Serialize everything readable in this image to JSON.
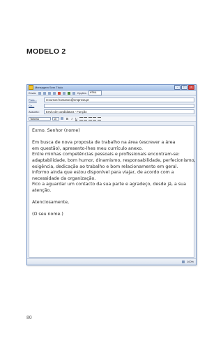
{
  "document": {
    "heading": "MODELO 2",
    "page_number": "80"
  },
  "window": {
    "title": "Mensagem Sem Título",
    "toolbar": {
      "send": "Enviar",
      "options": "Opções",
      "format": "HTML"
    },
    "headers": {
      "to_label": "Para...",
      "to_value": "recursos-humanos@empresa.pt",
      "cc_label": "Cc...",
      "cc_value": "",
      "subject_label": "Assunto:",
      "subject_value": "Envio de candidatura - Função"
    },
    "formatting": {
      "font": "Tahoma",
      "size": "10",
      "bold": "B",
      "italic": "I",
      "underline": "U"
    },
    "body": {
      "greeting": "Exmo. Senhor (nome)",
      "p1_line1": "Em busca de nova proposta de trabalho na área (escrever a área",
      "p1_line2": "em questão), apresento-lhes meu currículo anexo.",
      "p1_line3": "Entre minhas competências pessoais e profissionais encontram-se:",
      "p1_line4": "adaptabilidade, bom humor, dinamismo, responsabilidade, perfecionismo,",
      "p1_line5": "exigência, dedicação ao trabalho e bom relacionamento em geral.",
      "p1_line6": "Informo ainda que estou disponível para viajar, de acordo com a",
      "p1_line7": "necessidade da organização.",
      "p1_line8": "Fico a aguardar um contacto da sua parte e agradeço, desde já, a sua",
      "p1_line9": "atenção.",
      "closing": "Atenciosamente,",
      "signature": "(O seu nome.)"
    },
    "status": {
      "zoom": "100%"
    }
  },
  "colors": {
    "window_border": "#6d8fc4",
    "titlebar": "#b9cfee",
    "link_label": "#1d3e7a"
  }
}
